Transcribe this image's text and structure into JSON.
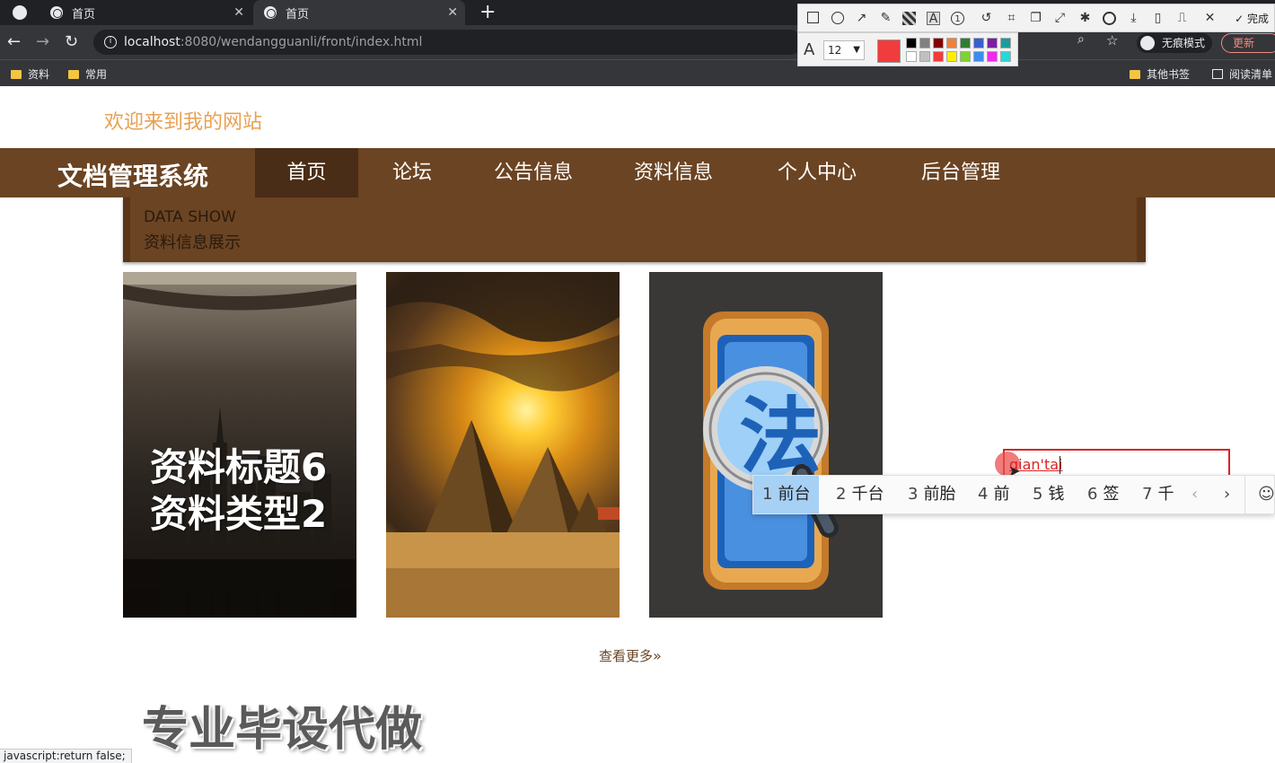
{
  "browser": {
    "tabs": [
      {
        "title": "首页",
        "active": false
      },
      {
        "title": "首页",
        "active": true
      }
    ],
    "new_tab_label": "+",
    "url_host": "localhost",
    "url_path": ":8080/wendangguanli/front/index.html",
    "bookmarks": [
      "资料",
      "常用"
    ],
    "bookmarks_right": [
      "其他书签",
      "阅读清单"
    ],
    "incognito_label": "无痕模式",
    "update_label": "更新",
    "status_text": "javascript:return false;"
  },
  "screenshot_tool": {
    "done_label": "完成",
    "font_size": "12",
    "current_color": "#f03c3c",
    "palette": [
      "#000000",
      "#808080",
      "#800000",
      "#f0803c",
      "#2e7d32",
      "#3a5fcd",
      "#7b1fa2",
      "#1a9c9c",
      "#ffffff",
      "#c0c0c0",
      "#f03c3c",
      "#ffee00",
      "#7cd42c",
      "#3c8cf0",
      "#f028f0",
      "#28d8d8"
    ]
  },
  "site": {
    "welcome": "欢迎来到我的网站",
    "brand": "文档管理系统",
    "nav": [
      "首页",
      "论坛",
      "公告信息",
      "资料信息",
      "个人中心",
      "后台管理"
    ],
    "active_nav": "首页",
    "section_en": "DATA SHOW",
    "section_cn": "资料信息展示",
    "cards": [
      {
        "title": "资料标题6",
        "type": "资料类型2",
        "image": "dark-city-image"
      },
      {
        "image": "desert-pyramids-image"
      },
      {
        "image": "law-magnifier-image"
      }
    ],
    "more_link": "查看更多",
    "promo": "专业毕设代做",
    "accent": "#6b4423"
  },
  "ime": {
    "composition": "qian'tai",
    "candidates": [
      "前台",
      "千台",
      "前胎",
      "前",
      "钱",
      "签",
      "千"
    ],
    "selected_index": 0
  }
}
